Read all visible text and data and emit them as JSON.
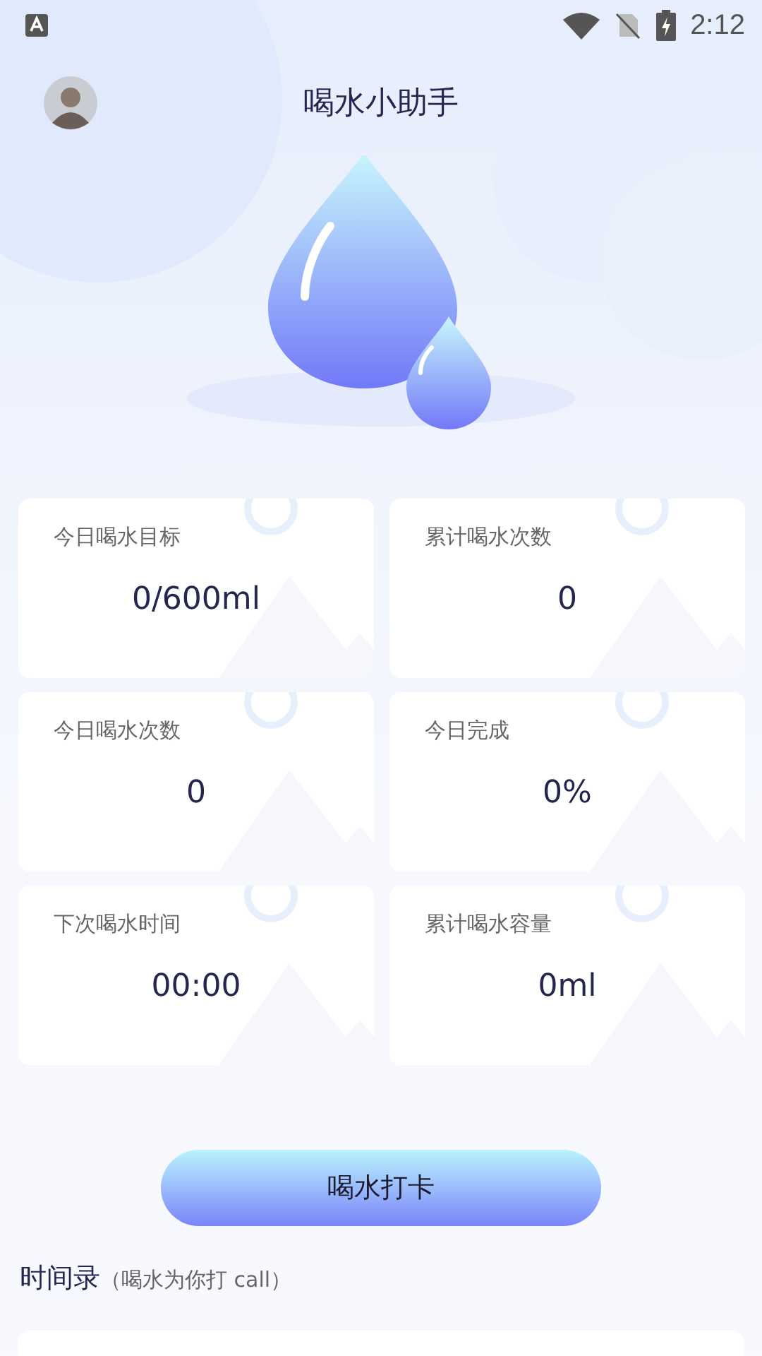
{
  "status_bar": {
    "time": "2:12"
  },
  "header": {
    "title": "喝水小助手"
  },
  "stats": [
    {
      "label": "今日喝水目标",
      "value": "0/600ml"
    },
    {
      "label": "累计喝水次数",
      "value": "0"
    },
    {
      "label": "今日喝水次数",
      "value": "0"
    },
    {
      "label": "今日完成",
      "value": "0%"
    },
    {
      "label": "下次喝水时间",
      "value": "00:00"
    },
    {
      "label": "累计喝水容量",
      "value": "0ml"
    }
  ],
  "checkin_button": "喝水打卡",
  "records": {
    "title": "时间录",
    "subtitle": "（喝水为你打 call）"
  }
}
